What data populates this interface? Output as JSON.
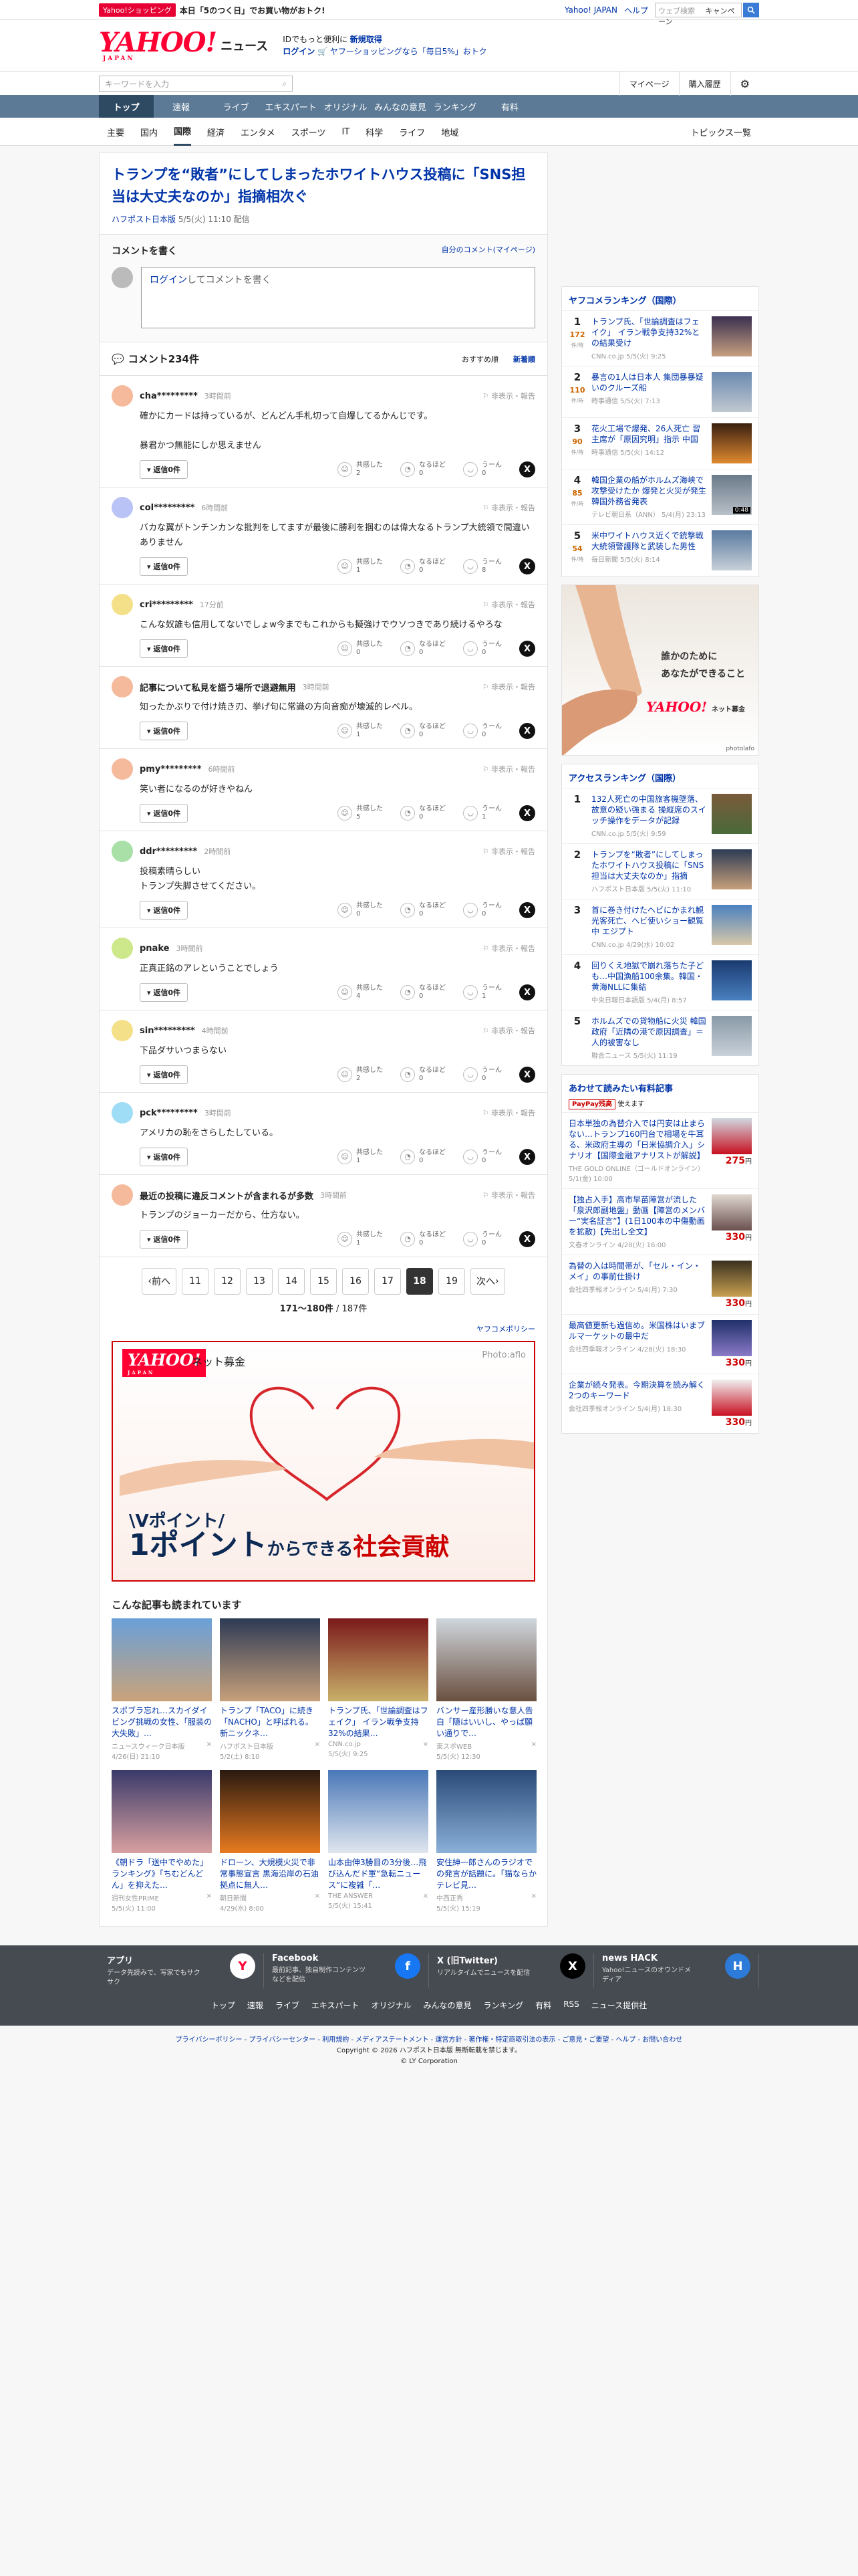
{
  "topbar": {
    "shop_badge": "Yahoo!ショッピング",
    "promo": "本日「5のつく日」でお買い物がおトク!",
    "links": [
      "Yahoo! JAPAN",
      "ヘルプ"
    ],
    "search_placeholder": "ウェブ検索",
    "search_mode": "キャンペーン"
  },
  "header": {
    "logo": "YAHOO!",
    "logo_sub": "JAPAN",
    "title": "ニュース",
    "line1_a": "IDでもっと便利に",
    "line1_b": "新規取得",
    "line2_a": "ログイン",
    "line2_b": "ヤフーショッピングなら「毎日5%」おトク"
  },
  "searchrow": {
    "placeholder": "キーワードを入力",
    "mypage": "マイページ",
    "purchased": "購入履歴"
  },
  "nav": {
    "items": [
      "トップ",
      "速報",
      "ライブ",
      "エキスパート",
      "オリジナル",
      "みんなの意見",
      "ランキング",
      "有料"
    ]
  },
  "subnav": {
    "items": [
      "主要",
      "国内",
      "国際",
      "経済",
      "エンタメ",
      "スポーツ",
      "IT",
      "科学",
      "ライフ",
      "地域"
    ],
    "topics": "トピックス一覧"
  },
  "article": {
    "title": "トランプを“敗者”にしてしまったホワイトハウス投稿に「SNS担当は大丈夫なのか」指摘相次ぐ",
    "source": "ハフポスト日本版",
    "date": "5/5(火) 11:10 配信"
  },
  "comment_write": {
    "heading": "コメントを書く",
    "mine": "自分のコメント(マイページ)",
    "login": "ログイン",
    "placeholder_rest": "してコメントを書く"
  },
  "comments_head": {
    "title": "コメント234件",
    "sort_recommend": "おすすめ順",
    "sort_new": "新着順"
  },
  "comments": [
    {
      "name": "cha*********",
      "time": "3時間前",
      "hide": "非表示・報告",
      "text": "確かにカードは持っているが、どんどん手札切って自爆してるかんじです。\n\n暴君かつ無能にしか思えません",
      "reply": "返信0件",
      "empathy": "2",
      "naruhodo": "0",
      "uun": "0"
    },
    {
      "name": "col*********",
      "time": "6時間前",
      "hide": "非表示・報告",
      "text": "バカな翼がトンチンカンな批判をしてますが最後に勝利を掴むのは偉大なるトランプ大統領で間違いありません",
      "reply": "返信0件",
      "empathy": "1",
      "naruhodo": "0",
      "uun": "8"
    },
    {
      "name": "cri*********",
      "time": "17分前",
      "hide": "非表示・報告",
      "text": "こんな奴誰も信用してないでしょw今までもこれからも擬強けでウソつきであり続けるやろな",
      "reply": "返信0件",
      "empathy": "0",
      "naruhodo": "0",
      "uun": "0"
    },
    {
      "name": "記事について私見を語う場所で退避無用",
      "time": "3時間前",
      "hide": "非表示・報告",
      "text": "知ったかぶりで付け焼き刃、挙げ句に常識の方向音痴が壊滅的レベル。",
      "reply": "返信0件",
      "empathy": "1",
      "naruhodo": "0",
      "uun": "0"
    },
    {
      "name": "pmy*********",
      "time": "6時間前",
      "hide": "非表示・報告",
      "text": "笑い者になるのが好きやねん",
      "reply": "返信0件",
      "empathy": "5",
      "naruhodo": "0",
      "uun": "1"
    },
    {
      "name": "ddr*********",
      "time": "2時間前",
      "hide": "非表示・報告",
      "text": "投稿素晴らしい\nトランプ失脚させてください。",
      "reply": "返信0件",
      "empathy": "0",
      "naruhodo": "0",
      "uun": "0"
    },
    {
      "name": "pnake",
      "time": "3時間前",
      "hide": "非表示・報告",
      "text": "正真正銘のアレということでしょう",
      "reply": "返信0件",
      "empathy": "4",
      "naruhodo": "0",
      "uun": "1"
    },
    {
      "name": "sin*********",
      "time": "4時間前",
      "hide": "非表示・報告",
      "text": "下品ダサいつまらない",
      "reply": "返信0件",
      "empathy": "2",
      "naruhodo": "0",
      "uun": "0"
    },
    {
      "name": "pck*********",
      "time": "3時間前",
      "hide": "非表示・報告",
      "text": "アメリカの恥をさらしたしている。",
      "reply": "返信0件",
      "empathy": "1",
      "naruhodo": "0",
      "uun": "0"
    },
    {
      "name": "最近の投稿に違反コメントが含まれるが多数",
      "time": "3時間前",
      "hide": "非表示・報告",
      "text": "トランプのジョーカーだから、仕方ない。",
      "reply": "返信0件",
      "empathy": "1",
      "naruhodo": "0",
      "uun": "0"
    }
  ],
  "reaction_labels": {
    "empathy": "共感した",
    "naruhodo": "なるほど",
    "uun": "うーん"
  },
  "pager": {
    "prev": "前へ",
    "pages": [
      "11",
      "12",
      "13",
      "14",
      "15",
      "16",
      "17",
      "18",
      "19"
    ],
    "current": "18",
    "next": "次へ",
    "range": "171〜180件",
    "total": "/ 187件",
    "policy": "ヤフコメポリシー"
  },
  "ad": {
    "logo": "YAHOO!",
    "logo_sub": "JAPAN",
    "donate": "ネット募金",
    "photo": "Photo:aflo",
    "line1": "\\Vポイント/",
    "line2a": "1ポイント",
    "line2b": "からできる",
    "line2c": "社会貢献"
  },
  "related": {
    "title": "こんな記事も読まれています",
    "items": [
      {
        "title": "スポブラ忘れ…スカイダイビング挑戦の女性、「服装の大失敗」…",
        "src": "ニュースウィーク日本版",
        "date": "4/26(日) 21:10"
      },
      {
        "title": "トランプ「TACO」に続き「NACHO」と呼ばれる。新ニックネ…",
        "src": "ハフポスト日本版",
        "date": "5/2(土) 8:10"
      },
      {
        "title": "トランプ氏、「世論調査はフェイク」 イラン戦争支持32%の結果…",
        "src": "CNN.co.jp",
        "date": "5/5(火) 9:25"
      },
      {
        "title": "バンサー産形勝いな意人告白「隠はいいし、やっぱ願い通りで…",
        "src": "東スポWEB",
        "date": "5/5(火) 12:30"
      },
      {
        "title": "《朝ドラ「送中でやめた」ランキング》「ちむどんどん」を抑えた…",
        "src": "週刊女性PRIME",
        "date": "5/5(火) 11:00"
      },
      {
        "title": "ドローン、大規模火災で非常事態宣言 黒海沿岸の石油拠点に無人…",
        "src": "朝日新聞",
        "date": "4/29(水) 8:00"
      },
      {
        "title": "山本由伸3勝目の3分後…飛び込んだド軍“急転ニュース”に複雑「…",
        "src": "THE ANSWER",
        "date": "5/5(火) 15:41"
      },
      {
        "title": "安住紳一郎さんのラジオでの発言が話題に。「猫ならかテレビ見…",
        "src": "中西正秀",
        "date": "5/5(火) 15:19"
      }
    ]
  },
  "ranking": {
    "title": "ヤフコメランキング（国際）",
    "unit": "件/時",
    "items": [
      {
        "rank": "1",
        "count": "172",
        "title": "トランプ氏、「世論調査はフェイク」 イラン戦争支持32%との結果受け",
        "meta": "CNN.co.jp 5/5(火) 9:25"
      },
      {
        "rank": "2",
        "count": "110",
        "title": "暴言の1人は日本人 集団暴暴疑いのクルーズ船",
        "meta": "時事通信 5/5(火) 7:13"
      },
      {
        "title": "花火工場で爆発、26人死亡 習主席が「原因究明」指示 中国",
        "rank": "3",
        "count": "90",
        "meta": "時事通信 5/5(火) 14:12"
      },
      {
        "rank": "4",
        "count": "85",
        "title": "韓国企業の船がホルムズ海峡で攻撃受けたか 爆発と火災が発生 韓国外務省発表",
        "meta": "テレビ朝日系（ANN） 5/4(月) 23:13",
        "dur": "0:48"
      },
      {
        "rank": "5",
        "count": "54",
        "title": "米中ワイトハウス近くで銃撃戦 大統領警護隊と武装した男性",
        "meta": "毎日新聞 5/5(火) 8:14"
      }
    ]
  },
  "side_ad": {
    "line1": "誰かのために",
    "line2": "あなたができること",
    "logo": "YAHOO!",
    "donate": "ネット募金",
    "credit": "photolafo"
  },
  "access": {
    "title": "アクセスランキング（国際）",
    "items": [
      {
        "rank": "1",
        "title": "132人死亡の中国旅客機墜落、故意の疑い強まる 操縦席のスイッチ操作をデータが記録",
        "meta": "CNN.co.jp 5/5(火) 9:59"
      },
      {
        "rank": "2",
        "title": "トランプを“敗者”にしてしまったホワイトハウス投稿に「SNS担当は大丈夫なのか」指摘",
        "meta": "ハフポスト日本版 5/5(火) 11:10"
      },
      {
        "rank": "3",
        "title": "首に巻き付けたヘビにかまれ観光客死亡、ヘビ使いショー観覧中 エジプト",
        "meta": "CNN.co.jp 4/29(水) 10:02"
      },
      {
        "rank": "4",
        "title": "回りくえ地獄で崩れ落ちた子ども…中国漁船100余集。韓国・黄海NLLに集結",
        "meta": "中央日報日本語版 5/4(月) 8:57"
      },
      {
        "rank": "5",
        "title": "ホルムズでの貨物船に火災 韓国政府「近隣の港で原因調査」＝人的被害なし",
        "meta": "聯合ニュース 5/5(火) 11:19"
      }
    ]
  },
  "paid": {
    "title": "あわせて読みたい有料記事",
    "badge": "PayPay残高",
    "badge_rest": "使えます",
    "yen": "円",
    "items": [
      {
        "title": "日本単独の為替介入では円安は止まらない…トランプ160円台で相場を牛耳る、米政府主導の「日米協調介入」シナリオ【国際金融アナリストが解説】",
        "meta": "THE GOLD ONLINE（ゴールドオンライン） 5/1(金) 10:00",
        "price": "275"
      },
      {
        "title": "【独占入手】高市早苗陣営が流した「泉沢郎副地盤」動画【陣営のメンバー“実名証言”】(1日100本の中傷動画を拡散)【先出し全文】",
        "meta": "文春オンライン 4/28(火) 16:00",
        "price": "330"
      },
      {
        "title": "為替の入は時間帯が、「セル・イン・メイ」の事前仕掛け",
        "meta": "会社四季報オンライン 5/4(月) 7:30",
        "price": "330"
      },
      {
        "title": "最高値更新も過信め。米国株はいまブルマーケットの最中だ",
        "meta": "会社四季報オンライン 4/28(火) 18:30",
        "price": "330"
      },
      {
        "title": "企業が続々発表。今期決算を読み解く2つのキーワード",
        "meta": "会社四季報オンライン 5/4(月) 18:30",
        "price": "330"
      }
    ]
  },
  "footer": {
    "apps": [
      {
        "name": "アプリ",
        "desc": "データ先読みで、写家でもサクサク",
        "icon": "Y"
      },
      {
        "name": "Facebook",
        "desc": "最前記事、独自制作コンテンツなどを配信",
        "icon": "f"
      },
      {
        "name": "X (旧Twitter)",
        "desc": "リアルタイムでニュースを配信",
        "icon": "X"
      },
      {
        "name": "news HACK",
        "desc": "Yahoo!ニュースのオウンドメディア",
        "icon": "H"
      }
    ],
    "links": [
      "トップ",
      "速報",
      "ライブ",
      "エキスパート",
      "オリジナル",
      "みんなの意見",
      "ランキング",
      "有料",
      "RSS",
      "ニュース提供社"
    ],
    "bottom_links": "プライバシーポリシー - プライバシーセンター - 利用規約 - メディアステートメント - 運営方針 - 著作権・特定商取引法の表示 - ご意見・ご要望 - ヘルプ - お問い合わせ",
    "copyright": "Copyright © 2026 ハフポスト日本版 無断転載を禁じます。",
    "corp": "© LY Corporation"
  },
  "colors": {
    "brand": "#ff0033",
    "link": "#0034a8",
    "nav": "#5c7a96",
    "nav_active": "#2e4a63"
  }
}
